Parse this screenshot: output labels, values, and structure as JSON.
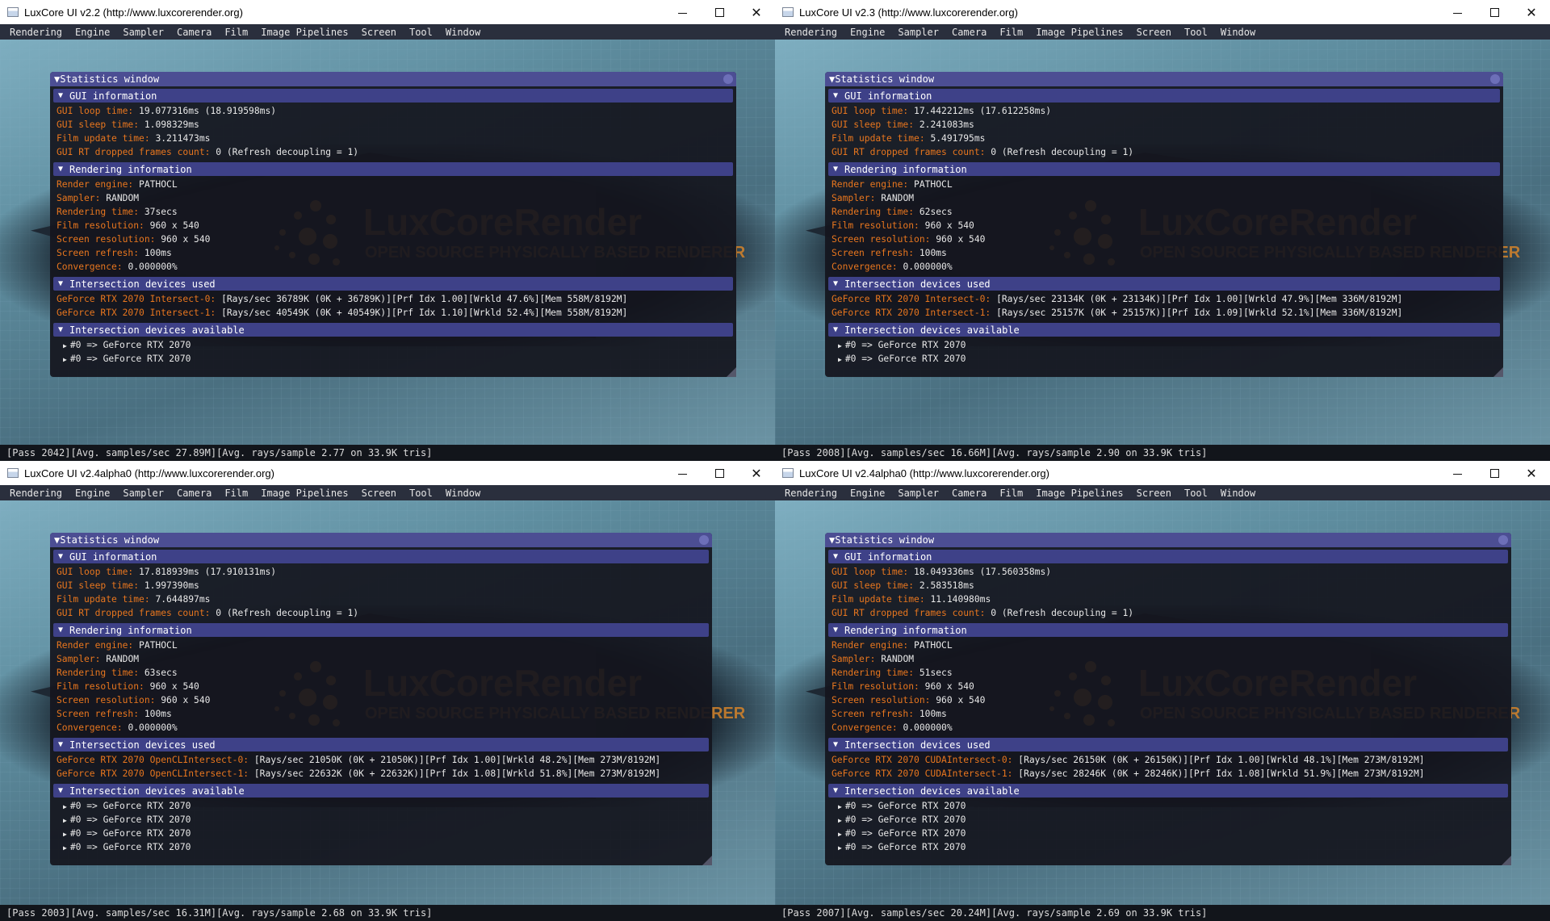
{
  "windows": [
    {
      "title": "LuxCore UI v2.2 (http://www.luxcorerender.org)",
      "menu": [
        "Rendering",
        "Engine",
        "Sampler",
        "Camera",
        "Film",
        "Image Pipelines",
        "Screen",
        "Tool",
        "Window"
      ],
      "statistics_title": "Statistics window",
      "gui_section": "GUI information",
      "gui": [
        {
          "k": "GUI loop time:",
          "v": "19.077316ms (18.919598ms)"
        },
        {
          "k": "GUI sleep time:",
          "v": "1.098329ms"
        },
        {
          "k": "Film update time:",
          "v": "3.211473ms"
        },
        {
          "k": "GUI RT dropped frames count:",
          "v": "0 (Refresh decoupling = 1)"
        }
      ],
      "render_section": "Rendering information",
      "render": [
        {
          "k": "Render engine:",
          "v": "PATHOCL"
        },
        {
          "k": "Sampler:",
          "v": "RANDOM"
        },
        {
          "k": "Rendering time:",
          "v": "37secs"
        },
        {
          "k": "Film resolution:",
          "v": "960 x 540"
        },
        {
          "k": "Screen resolution:",
          "v": "960 x 540"
        },
        {
          "k": "Screen refresh:",
          "v": "100ms"
        },
        {
          "k": "Convergence:",
          "v": "0.000000%"
        }
      ],
      "used_section": "Intersection devices used",
      "used": [
        {
          "k": "GeForce RTX 2070 Intersect-0:",
          "v": "[Rays/sec 36789K (0K + 36789K)][Prf Idx 1.00][Wrkld 47.6%][Mem 558M/8192M]"
        },
        {
          "k": "GeForce RTX 2070 Intersect-1:",
          "v": "[Rays/sec 40549K (0K + 40549K)][Prf Idx 1.10][Wrkld 52.4%][Mem 558M/8192M]"
        }
      ],
      "avail_section": "Intersection devices available",
      "available": [
        "#0 => GeForce RTX 2070",
        "#0 => GeForce RTX 2070"
      ],
      "logo_text": "LuxCoreRender",
      "logo_sub": "OPEN SOURCE PHYSICALLY BASED RENDERER",
      "status": "[Pass 2042][Avg. samples/sec  27.89M][Avg. rays/sample 2.77 on 33.9K tris]"
    },
    {
      "title": "LuxCore UI v2.3 (http://www.luxcorerender.org)",
      "menu": [
        "Rendering",
        "Engine",
        "Sampler",
        "Camera",
        "Film",
        "Image Pipelines",
        "Screen",
        "Tool",
        "Window"
      ],
      "statistics_title": "Statistics window",
      "gui_section": "GUI information",
      "gui": [
        {
          "k": "GUI loop time:",
          "v": "17.442212ms (17.612258ms)"
        },
        {
          "k": "GUI sleep time:",
          "v": "2.241083ms"
        },
        {
          "k": "Film update time:",
          "v": "5.491795ms"
        },
        {
          "k": "GUI RT dropped frames count:",
          "v": "0 (Refresh decoupling = 1)"
        }
      ],
      "render_section": "Rendering information",
      "render": [
        {
          "k": "Render engine:",
          "v": "PATHOCL"
        },
        {
          "k": "Sampler:",
          "v": "RANDOM"
        },
        {
          "k": "Rendering time:",
          "v": "62secs"
        },
        {
          "k": "Film resolution:",
          "v": "960 x 540"
        },
        {
          "k": "Screen resolution:",
          "v": "960 x 540"
        },
        {
          "k": "Screen refresh:",
          "v": "100ms"
        },
        {
          "k": "Convergence:",
          "v": "0.000000%"
        }
      ],
      "used_section": "Intersection devices used",
      "used": [
        {
          "k": "GeForce RTX 2070 Intersect-0:",
          "v": "[Rays/sec 23134K (0K + 23134K)][Prf Idx 1.00][Wrkld 47.9%][Mem 336M/8192M]"
        },
        {
          "k": "GeForce RTX 2070 Intersect-1:",
          "v": "[Rays/sec 25157K (0K + 25157K)][Prf Idx 1.09][Wrkld 52.1%][Mem 336M/8192M]"
        }
      ],
      "avail_section": "Intersection devices available",
      "available": [
        "#0 => GeForce RTX 2070",
        "#0 => GeForce RTX 2070"
      ],
      "logo_text": "LuxCoreRender",
      "logo_sub": "OPEN SOURCE PHYSICALLY BASED RENDERER",
      "status": "[Pass 2008][Avg. samples/sec  16.66M][Avg. rays/sample 2.90 on 33.9K tris]"
    },
    {
      "title": "LuxCore UI v2.4alpha0 (http://www.luxcorerender.org)",
      "menu": [
        "Rendering",
        "Engine",
        "Sampler",
        "Camera",
        "Film",
        "Image Pipelines",
        "Screen",
        "Tool",
        "Window"
      ],
      "statistics_title": "Statistics window",
      "gui_section": "GUI information",
      "gui": [
        {
          "k": "GUI loop time:",
          "v": "17.818939ms (17.910131ms)"
        },
        {
          "k": "GUI sleep time:",
          "v": "1.997390ms"
        },
        {
          "k": "Film update time:",
          "v": "7.644897ms"
        },
        {
          "k": "GUI RT dropped frames count:",
          "v": "0 (Refresh decoupling = 1)"
        }
      ],
      "render_section": "Rendering information",
      "render": [
        {
          "k": "Render engine:",
          "v": "PATHOCL"
        },
        {
          "k": "Sampler:",
          "v": "RANDOM"
        },
        {
          "k": "Rendering time:",
          "v": "63secs"
        },
        {
          "k": "Film resolution:",
          "v": "960 x 540"
        },
        {
          "k": "Screen resolution:",
          "v": "960 x 540"
        },
        {
          "k": "Screen refresh:",
          "v": "100ms"
        },
        {
          "k": "Convergence:",
          "v": "0.000000%"
        }
      ],
      "used_section": "Intersection devices used",
      "used": [
        {
          "k": "GeForce RTX 2070 OpenCLIntersect-0:",
          "v": "[Rays/sec 21050K (0K + 21050K)][Prf Idx 1.00][Wrkld 48.2%][Mem 273M/8192M]"
        },
        {
          "k": "GeForce RTX 2070 OpenCLIntersect-1:",
          "v": "[Rays/sec 22632K (0K + 22632K)][Prf Idx 1.08][Wrkld 51.8%][Mem 273M/8192M]"
        }
      ],
      "avail_section": "Intersection devices available",
      "available": [
        "#0 => GeForce RTX 2070",
        "#0 => GeForce RTX 2070",
        "#0 => GeForce RTX 2070",
        "#0 => GeForce RTX 2070"
      ],
      "logo_text": "LuxCoreRender",
      "logo_sub": "OPEN SOURCE PHYSICALLY BASED RENDERER",
      "status": "[Pass 2003][Avg. samples/sec  16.31M][Avg. rays/sample 2.68 on 33.9K tris]"
    },
    {
      "title": "LuxCore UI v2.4alpha0 (http://www.luxcorerender.org)",
      "menu": [
        "Rendering",
        "Engine",
        "Sampler",
        "Camera",
        "Film",
        "Image Pipelines",
        "Screen",
        "Tool",
        "Window"
      ],
      "statistics_title": "Statistics window",
      "gui_section": "GUI information",
      "gui": [
        {
          "k": "GUI loop time:",
          "v": "18.049336ms (17.560358ms)"
        },
        {
          "k": "GUI sleep time:",
          "v": "2.583518ms"
        },
        {
          "k": "Film update time:",
          "v": "11.140980ms"
        },
        {
          "k": "GUI RT dropped frames count:",
          "v": "0 (Refresh decoupling = 1)"
        }
      ],
      "render_section": "Rendering information",
      "render": [
        {
          "k": "Render engine:",
          "v": "PATHOCL"
        },
        {
          "k": "Sampler:",
          "v": "RANDOM"
        },
        {
          "k": "Rendering time:",
          "v": "51secs"
        },
        {
          "k": "Film resolution:",
          "v": "960 x 540"
        },
        {
          "k": "Screen resolution:",
          "v": "960 x 540"
        },
        {
          "k": "Screen refresh:",
          "v": "100ms"
        },
        {
          "k": "Convergence:",
          "v": "0.000000%"
        }
      ],
      "used_section": "Intersection devices used",
      "used": [
        {
          "k": "GeForce RTX 2070 CUDAIntersect-0:",
          "v": "[Rays/sec 26150K (0K + 26150K)][Prf Idx 1.00][Wrkld 48.1%][Mem 273M/8192M]"
        },
        {
          "k": "GeForce RTX 2070 CUDAIntersect-1:",
          "v": "[Rays/sec 28246K (0K + 28246K)][Prf Idx 1.08][Wrkld 51.9%][Mem 273M/8192M]"
        }
      ],
      "avail_section": "Intersection devices available",
      "available": [
        "#0 => GeForce RTX 2070",
        "#0 => GeForce RTX 2070",
        "#0 => GeForce RTX 2070",
        "#0 => GeForce RTX 2070"
      ],
      "logo_text": "LuxCoreRender",
      "logo_sub": "OPEN SOURCE PHYSICALLY BASED RENDERER",
      "status": "[Pass 2007][Avg. samples/sec  20.24M][Avg. rays/sample 2.69 on 33.9K tris]"
    }
  ],
  "colors": {
    "accent": "#4c4e93",
    "section": "#3e4188",
    "key": "#e8761e",
    "logo": "#d6842a"
  }
}
